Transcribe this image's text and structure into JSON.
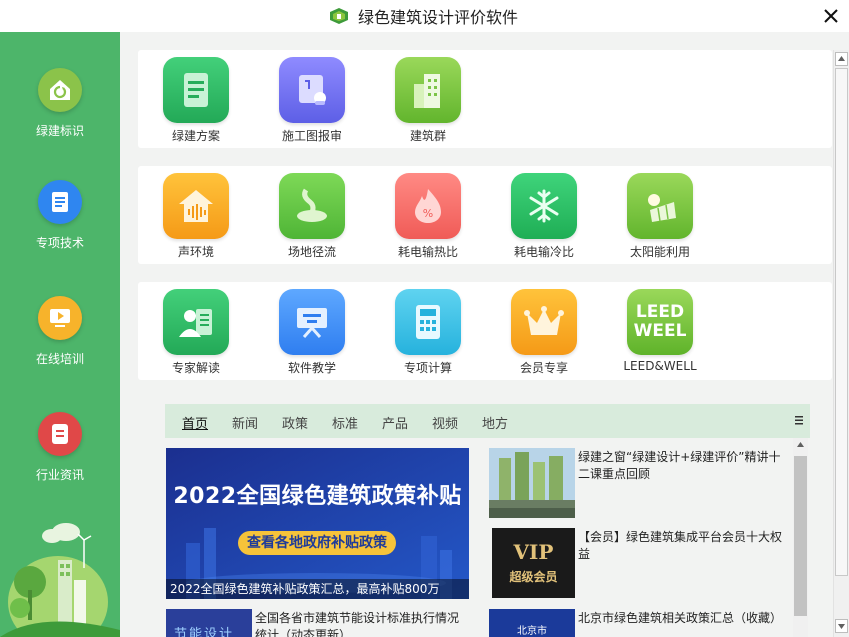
{
  "window": {
    "title": "绿色建筑设计评价软件"
  },
  "sidebar": {
    "items": [
      {
        "label": "绿建标识",
        "icon": "green-building-label-icon",
        "color": "#8bc34a"
      },
      {
        "label": "专项技术",
        "icon": "document-icon",
        "color": "#2f86f0"
      },
      {
        "label": "在线培训",
        "icon": "video-play-icon",
        "color": "#f7b32b"
      },
      {
        "label": "行业资讯",
        "icon": "news-icon",
        "color": "#e04848"
      }
    ]
  },
  "panels": {
    "row1": [
      {
        "label": "绿建方案",
        "icon": "plan-document-icon"
      },
      {
        "label": "施工图报审",
        "icon": "blueprint-review-icon"
      },
      {
        "label": "建筑群",
        "icon": "building-group-icon"
      }
    ],
    "row2": [
      {
        "label": "声环境",
        "icon": "sound-environment-icon"
      },
      {
        "label": "场地径流",
        "icon": "site-runoff-icon"
      },
      {
        "label": "耗电输热比",
        "icon": "flame-percent-icon"
      },
      {
        "label": "耗电输冷比",
        "icon": "snowflake-icon"
      },
      {
        "label": "太阳能利用",
        "icon": "solar-panel-icon"
      }
    ],
    "row3": [
      {
        "label": "专家解读",
        "icon": "expert-icon"
      },
      {
        "label": "软件教学",
        "icon": "teaching-screen-icon"
      },
      {
        "label": "专项计算",
        "icon": "calculator-icon"
      },
      {
        "label": "会员专享",
        "icon": "crown-icon"
      },
      {
        "label": "LEED&WELL",
        "icon": "leed-well-icon",
        "icon_text_1": "LEED",
        "icon_text_2": "WEEL"
      }
    ]
  },
  "news": {
    "tabs": [
      "首页",
      "新闻",
      "政策",
      "标准",
      "产品",
      "视频",
      "地方"
    ],
    "active_tab": "首页",
    "banner": {
      "headline": "2022全国绿色建筑政策补贴",
      "button": "查看各地政府补贴政策",
      "caption": "2022全国绿色建筑补贴政策汇总，最高补贴800万"
    },
    "items": [
      {
        "title": "绿建之窗“绿建设计+绿建评价”精讲十二课重点回顾"
      },
      {
        "title": "【会员】绿色建筑集成平台会员十大权益",
        "thumb_text_1": "VIP",
        "thumb_text_2": "超级会员"
      },
      {
        "title": "全国各省市建筑节能设计标准执行情况统计（动态更新）",
        "thumb_text": "节能设计"
      },
      {
        "title": "北京市绿色建筑相关政策汇总（收藏）",
        "thumb_text": "北京市"
      }
    ]
  },
  "colors": {
    "sidebar": "#4db56a",
    "tab_bar": "#d8ebdc",
    "accent_green": "#3fb860",
    "banner_blue": "#1d3fa8",
    "banner_button": "#f6c33a"
  }
}
